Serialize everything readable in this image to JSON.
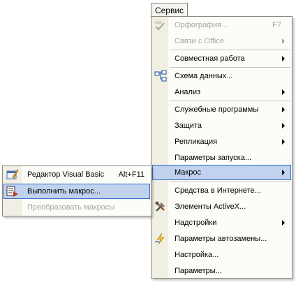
{
  "menubar": {
    "title": "Сервис"
  },
  "menu": {
    "items": [
      {
        "label": "Орфография...",
        "shortcut": "F7",
        "icon": "spellcheck-icon",
        "disabled": true
      },
      {
        "label": "Связи с Office",
        "submenu": true,
        "disabled": true
      },
      {
        "label": "Совместная работа",
        "submenu": true
      },
      {
        "label": "Схема данных...",
        "icon": "relationships-icon"
      },
      {
        "label": "Анализ",
        "submenu": true
      },
      {
        "label": "Служебные программы",
        "submenu": true
      },
      {
        "label": "Защита",
        "submenu": true
      },
      {
        "label": "Репликация",
        "submenu": true
      },
      {
        "label": "Параметры запуска..."
      },
      {
        "label": "Макрос",
        "submenu": true,
        "highlighted": true
      },
      {
        "label": "Средства в Интернете..."
      },
      {
        "label": "Элементы ActiveX...",
        "icon": "activex-tools-icon"
      },
      {
        "label": "Надстройки",
        "submenu": true
      },
      {
        "label": "Параметры автозамены...",
        "icon": "autocorrect-icon"
      },
      {
        "label": "Настройка..."
      },
      {
        "label": "Параметры..."
      }
    ]
  },
  "submenu": {
    "items": [
      {
        "label": "Редактор Visual Basic",
        "shortcut": "Alt+F11",
        "icon": "vb-editor-icon"
      },
      {
        "label": "Выполнить макрос...",
        "icon": "run-macro-icon",
        "highlighted": true
      },
      {
        "label": "Преобразовать макросы",
        "disabled": true
      }
    ]
  },
  "colors": {
    "highlight_bg": "#c1d2ee",
    "highlight_border": "#316ac5",
    "disabled_text": "#a8a69b",
    "gutter": "#f1efe4"
  }
}
